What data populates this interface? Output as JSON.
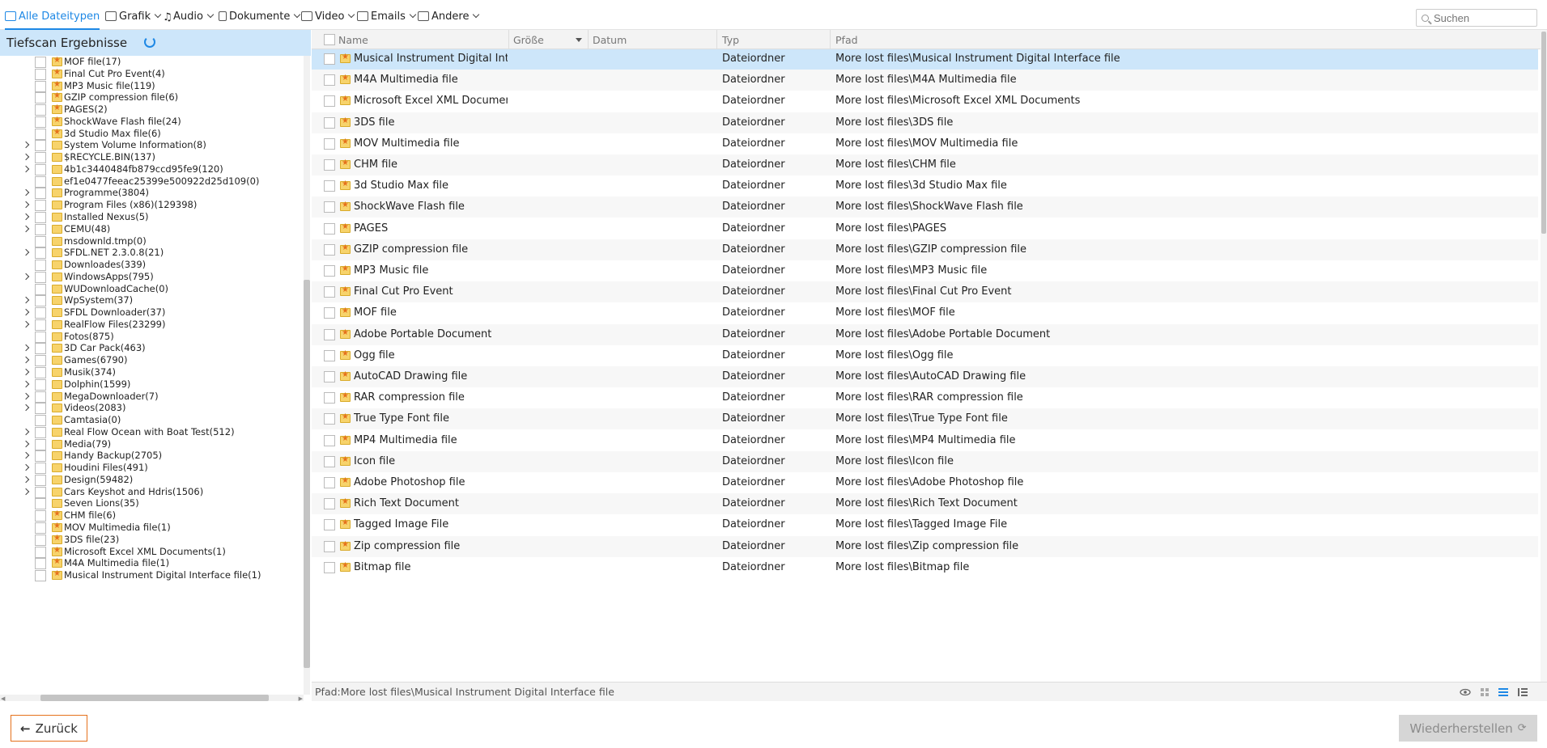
{
  "filter_tabs": [
    {
      "label": "Alle Dateitypen",
      "icon": "monitor-icon",
      "active": true
    },
    {
      "label": "Grafik",
      "icon": "image-icon",
      "dropdown": true
    },
    {
      "label": "Audio",
      "icon": "music-note-icon",
      "dropdown": true
    },
    {
      "label": "Dokumente",
      "icon": "document-icon",
      "dropdown": true
    },
    {
      "label": "Video",
      "icon": "video-icon",
      "dropdown": true
    },
    {
      "label": "Emails",
      "icon": "mail-icon",
      "dropdown": true
    },
    {
      "label": "Andere",
      "icon": "folder-icon",
      "dropdown": true
    }
  ],
  "search": {
    "placeholder": "Suchen"
  },
  "left_panel": {
    "title": "Tiefscan Ergebnisse",
    "tree": [
      {
        "label": "MOF file(17)",
        "expandable": false,
        "star": true
      },
      {
        "label": "Final Cut Pro Event(4)",
        "expandable": false,
        "star": true
      },
      {
        "label": "MP3 Music file(119)",
        "expandable": false,
        "star": true
      },
      {
        "label": "GZIP compression file(6)",
        "expandable": false,
        "star": true
      },
      {
        "label": "PAGES(2)",
        "expandable": false,
        "star": true
      },
      {
        "label": "ShockWave Flash file(24)",
        "expandable": false,
        "star": true
      },
      {
        "label": "3d Studio Max file(6)",
        "expandable": false,
        "star": true
      },
      {
        "label": "System Volume Information(8)",
        "expandable": true,
        "star": false
      },
      {
        "label": "$RECYCLE.BIN(137)",
        "expandable": true,
        "star": false
      },
      {
        "label": "4b1c3440484fb879ccd95fe9(120)",
        "expandable": true,
        "star": false
      },
      {
        "label": "ef1e0477feeac25399e500922d25d109(0)",
        "expandable": false,
        "star": false
      },
      {
        "label": "Programme(3804)",
        "expandable": true,
        "star": false
      },
      {
        "label": "Program Files (x86)(129398)",
        "expandable": true,
        "star": false
      },
      {
        "label": "Installed Nexus(5)",
        "expandable": true,
        "star": false
      },
      {
        "label": "CEMU(48)",
        "expandable": true,
        "star": false
      },
      {
        "label": "msdownld.tmp(0)",
        "expandable": false,
        "star": false
      },
      {
        "label": "SFDL.NET 2.3.0.8(21)",
        "expandable": true,
        "star": false
      },
      {
        "label": "Downloades(339)",
        "expandable": false,
        "star": false
      },
      {
        "label": "WindowsApps(795)",
        "expandable": true,
        "star": false
      },
      {
        "label": "WUDownloadCache(0)",
        "expandable": false,
        "star": false
      },
      {
        "label": "WpSystem(37)",
        "expandable": true,
        "star": false
      },
      {
        "label": "SFDL Downloader(37)",
        "expandable": true,
        "star": false
      },
      {
        "label": "RealFlow Files(23299)",
        "expandable": true,
        "star": false
      },
      {
        "label": "Fotos(875)",
        "expandable": false,
        "star": false
      },
      {
        "label": "3D Car Pack(463)",
        "expandable": true,
        "star": false
      },
      {
        "label": "Games(6790)",
        "expandable": true,
        "star": false
      },
      {
        "label": "Musik(374)",
        "expandable": true,
        "star": false
      },
      {
        "label": "Dolphin(1599)",
        "expandable": true,
        "star": false
      },
      {
        "label": "MegaDownloader(7)",
        "expandable": true,
        "star": false
      },
      {
        "label": "Videos(2083)",
        "expandable": true,
        "star": false
      },
      {
        "label": "Camtasia(0)",
        "expandable": false,
        "star": false
      },
      {
        "label": "Real Flow Ocean with Boat Test(512)",
        "expandable": true,
        "star": false
      },
      {
        "label": "Media(79)",
        "expandable": true,
        "star": false
      },
      {
        "label": "Handy Backup(2705)",
        "expandable": true,
        "star": false
      },
      {
        "label": "Houdini Files(491)",
        "expandable": true,
        "star": false
      },
      {
        "label": "Design(59482)",
        "expandable": true,
        "star": false
      },
      {
        "label": "Cars Keyshot and Hdris(1506)",
        "expandable": true,
        "star": false
      },
      {
        "label": "Seven Lions(35)",
        "expandable": false,
        "star": false
      },
      {
        "label": "CHM file(6)",
        "expandable": false,
        "star": true
      },
      {
        "label": "MOV Multimedia file(1)",
        "expandable": false,
        "star": true
      },
      {
        "label": "3DS file(23)",
        "expandable": false,
        "star": true
      },
      {
        "label": "Microsoft Excel XML Documents(1)",
        "expandable": false,
        "star": true
      },
      {
        "label": "M4A Multimedia file(1)",
        "expandable": false,
        "star": true
      },
      {
        "label": "Musical Instrument Digital Interface file(1)",
        "expandable": false,
        "star": true
      }
    ]
  },
  "table": {
    "columns": [
      "Name",
      "Größe",
      "Datum",
      "Typ",
      "Pfad"
    ],
    "rows": [
      {
        "name": "Musical Instrument Digital Inte...",
        "size": "",
        "date": "",
        "type": "Dateiordner",
        "path": "More lost files\\Musical Instrument Digital Interface file",
        "selected": true
      },
      {
        "name": "M4A Multimedia file",
        "size": "",
        "date": "",
        "type": "Dateiordner",
        "path": "More lost files\\M4A Multimedia file"
      },
      {
        "name": "Microsoft Excel XML Documents",
        "size": "",
        "date": "",
        "type": "Dateiordner",
        "path": "More lost files\\Microsoft Excel XML Documents"
      },
      {
        "name": "3DS file",
        "size": "",
        "date": "",
        "type": "Dateiordner",
        "path": "More lost files\\3DS file"
      },
      {
        "name": "MOV Multimedia file",
        "size": "",
        "date": "",
        "type": "Dateiordner",
        "path": "More lost files\\MOV Multimedia file"
      },
      {
        "name": "CHM file",
        "size": "",
        "date": "",
        "type": "Dateiordner",
        "path": "More lost files\\CHM file"
      },
      {
        "name": "3d Studio Max file",
        "size": "",
        "date": "",
        "type": "Dateiordner",
        "path": "More lost files\\3d Studio Max file"
      },
      {
        "name": "ShockWave Flash file",
        "size": "",
        "date": "",
        "type": "Dateiordner",
        "path": "More lost files\\ShockWave Flash file"
      },
      {
        "name": "PAGES",
        "size": "",
        "date": "",
        "type": "Dateiordner",
        "path": "More lost files\\PAGES"
      },
      {
        "name": "GZIP compression file",
        "size": "",
        "date": "",
        "type": "Dateiordner",
        "path": "More lost files\\GZIP compression file"
      },
      {
        "name": "MP3 Music file",
        "size": "",
        "date": "",
        "type": "Dateiordner",
        "path": "More lost files\\MP3 Music file"
      },
      {
        "name": "Final Cut Pro Event",
        "size": "",
        "date": "",
        "type": "Dateiordner",
        "path": "More lost files\\Final Cut Pro Event"
      },
      {
        "name": "MOF file",
        "size": "",
        "date": "",
        "type": "Dateiordner",
        "path": "More lost files\\MOF file"
      },
      {
        "name": "Adobe Portable Document",
        "size": "",
        "date": "",
        "type": "Dateiordner",
        "path": "More lost files\\Adobe Portable Document"
      },
      {
        "name": "Ogg file",
        "size": "",
        "date": "",
        "type": "Dateiordner",
        "path": "More lost files\\Ogg file"
      },
      {
        "name": "AutoCAD Drawing file",
        "size": "",
        "date": "",
        "type": "Dateiordner",
        "path": "More lost files\\AutoCAD Drawing file"
      },
      {
        "name": "RAR compression file",
        "size": "",
        "date": "",
        "type": "Dateiordner",
        "path": "More lost files\\RAR compression file"
      },
      {
        "name": "True Type Font file",
        "size": "",
        "date": "",
        "type": "Dateiordner",
        "path": "More lost files\\True Type Font file"
      },
      {
        "name": "MP4 Multimedia file",
        "size": "",
        "date": "",
        "type": "Dateiordner",
        "path": "More lost files\\MP4 Multimedia file"
      },
      {
        "name": "Icon file",
        "size": "",
        "date": "",
        "type": "Dateiordner",
        "path": "More lost files\\Icon file"
      },
      {
        "name": "Adobe Photoshop file",
        "size": "",
        "date": "",
        "type": "Dateiordner",
        "path": "More lost files\\Adobe Photoshop file"
      },
      {
        "name": "Rich Text Document",
        "size": "",
        "date": "",
        "type": "Dateiordner",
        "path": "More lost files\\Rich Text Document"
      },
      {
        "name": "Tagged Image File",
        "size": "",
        "date": "",
        "type": "Dateiordner",
        "path": "More lost files\\Tagged Image File"
      },
      {
        "name": "Zip compression file",
        "size": "",
        "date": "",
        "type": "Dateiordner",
        "path": "More lost files\\Zip compression file"
      },
      {
        "name": "Bitmap file",
        "size": "",
        "date": "",
        "type": "Dateiordner",
        "path": "More lost files\\Bitmap file"
      }
    ]
  },
  "status_bar": {
    "path": "Pfad:More lost files\\Musical Instrument Digital Interface file"
  },
  "view_icons": [
    "eye-icon",
    "thumbnail-view-icon",
    "list-view-icon",
    "detail-view-icon"
  ],
  "buttons": {
    "back": "Zurück",
    "restore": "Wiederherstellen"
  },
  "colors": {
    "accent": "#1e88e5",
    "selected_row": "#cde6fa",
    "back_border": "#e5711c",
    "folder": "#f7d36b",
    "star": "#e5711c"
  }
}
